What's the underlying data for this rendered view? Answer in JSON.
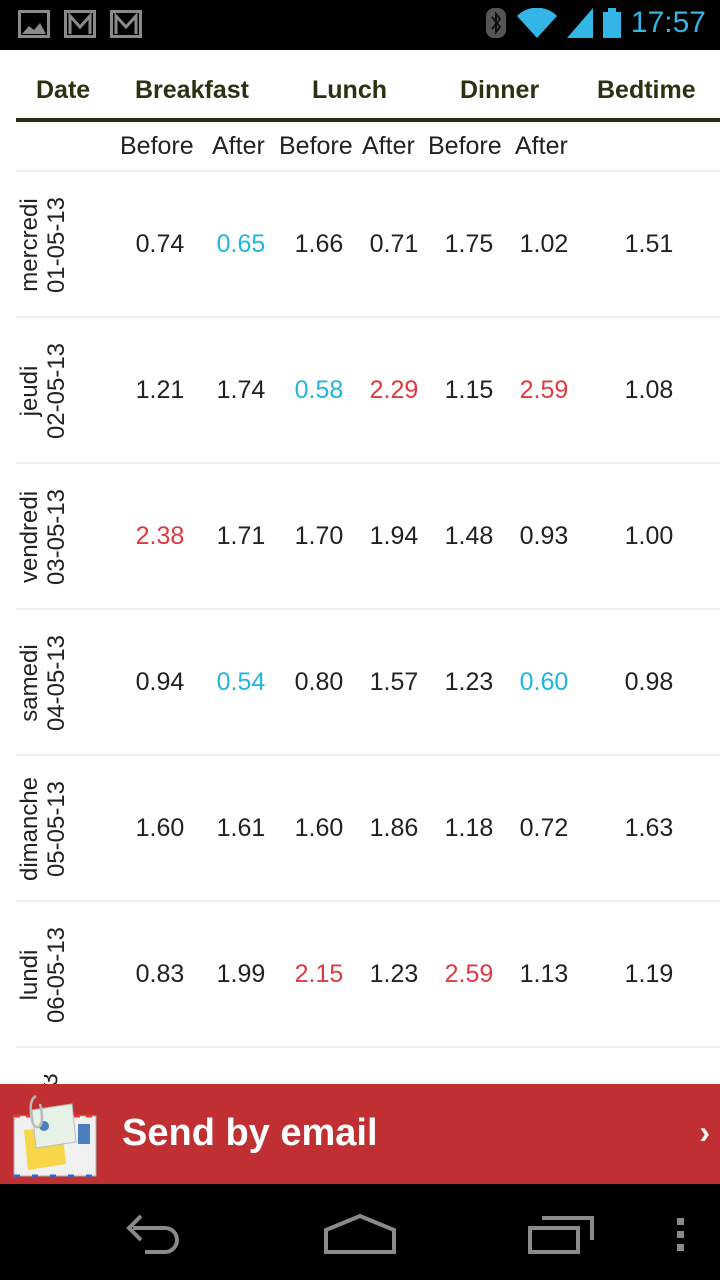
{
  "status_bar": {
    "time": "17:57",
    "left_icons": [
      "image-icon",
      "gmail-icon",
      "gmail-icon"
    ],
    "right_icons": [
      "bluetooth-icon",
      "wifi-icon",
      "signal-icon",
      "battery-icon"
    ]
  },
  "table": {
    "headers": [
      "Date",
      "Breakfast",
      "Lunch",
      "Dinner",
      "Bedtime"
    ],
    "subheaders": [
      "Before",
      "After",
      "Before",
      "After",
      "Before",
      "After"
    ],
    "rows": [
      {
        "day": "mercredi",
        "date": "01-05-13",
        "values": [
          "0.74",
          "0.65",
          "1.66",
          "0.71",
          "1.75",
          "1.02",
          "1.51"
        ],
        "status": [
          "normal",
          "low",
          "normal",
          "normal",
          "normal",
          "normal",
          "normal"
        ]
      },
      {
        "day": "jeudi",
        "date": "02-05-13",
        "values": [
          "1.21",
          "1.74",
          "0.58",
          "2.29",
          "1.15",
          "2.59",
          "1.08"
        ],
        "status": [
          "normal",
          "normal",
          "low",
          "high",
          "normal",
          "high",
          "normal"
        ]
      },
      {
        "day": "vendredi",
        "date": "03-05-13",
        "values": [
          "2.38",
          "1.71",
          "1.70",
          "1.94",
          "1.48",
          "0.93",
          "1.00"
        ],
        "status": [
          "high",
          "normal",
          "normal",
          "normal",
          "normal",
          "normal",
          "normal"
        ]
      },
      {
        "day": "samedi",
        "date": "04-05-13",
        "values": [
          "0.94",
          "0.54",
          "0.80",
          "1.57",
          "1.23",
          "0.60",
          "0.98"
        ],
        "status": [
          "normal",
          "low",
          "normal",
          "normal",
          "normal",
          "low",
          "normal"
        ]
      },
      {
        "day": "dimanche",
        "date": "05-05-13",
        "values": [
          "1.60",
          "1.61",
          "1.60",
          "1.86",
          "1.18",
          "0.72",
          "1.63"
        ],
        "status": [
          "normal",
          "normal",
          "normal",
          "normal",
          "normal",
          "normal",
          "normal"
        ]
      },
      {
        "day": "lundi",
        "date": "06-05-13",
        "values": [
          "0.83",
          "1.99",
          "2.15",
          "1.23",
          "2.59",
          "1.13",
          "1.19"
        ],
        "status": [
          "normal",
          "normal",
          "high",
          "normal",
          "high",
          "normal",
          "normal"
        ]
      }
    ],
    "partial_next_row_fragment": "3"
  },
  "colors": {
    "header_text": "#2a3311",
    "low_value": "#1fb6dd",
    "high_value": "#e0393e",
    "action_bar": "#c03033",
    "clock": "#33b5e5"
  },
  "action": {
    "label": "Send by email",
    "icon": "email-attachment-icon",
    "chevron": "›"
  },
  "nav": [
    "back-icon",
    "home-icon",
    "recent-apps-icon",
    "overflow-menu-icon"
  ]
}
